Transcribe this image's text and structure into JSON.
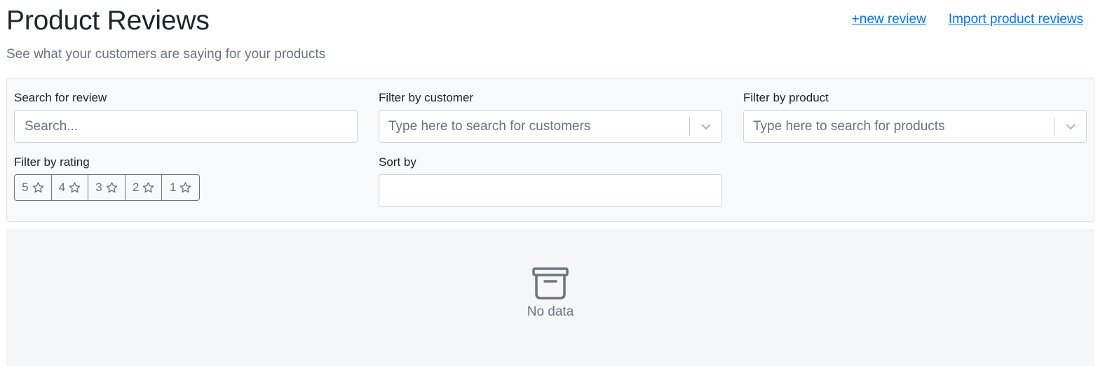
{
  "header": {
    "title": "Product Reviews",
    "subtitle": "See what your customers are saying for your products",
    "new_review_link": "+new review",
    "import_link": "Import product reviews"
  },
  "filters": {
    "search_label": "Search for review",
    "search_placeholder": "Search...",
    "customer_label": "Filter by customer",
    "customer_placeholder": "Type here to search for customers",
    "product_label": "Filter by product",
    "product_placeholder": "Type here to search for products",
    "rating_label": "Filter by rating",
    "ratings": [
      "5",
      "4",
      "3",
      "2",
      "1"
    ],
    "sort_label": "Sort by",
    "sort_value": ""
  },
  "empty_state": {
    "icon": "archive-box-icon",
    "text": "No data"
  },
  "colors": {
    "link": "#0d6efd",
    "muted": "#6c757d",
    "panel_bg": "#f8f9fa"
  }
}
